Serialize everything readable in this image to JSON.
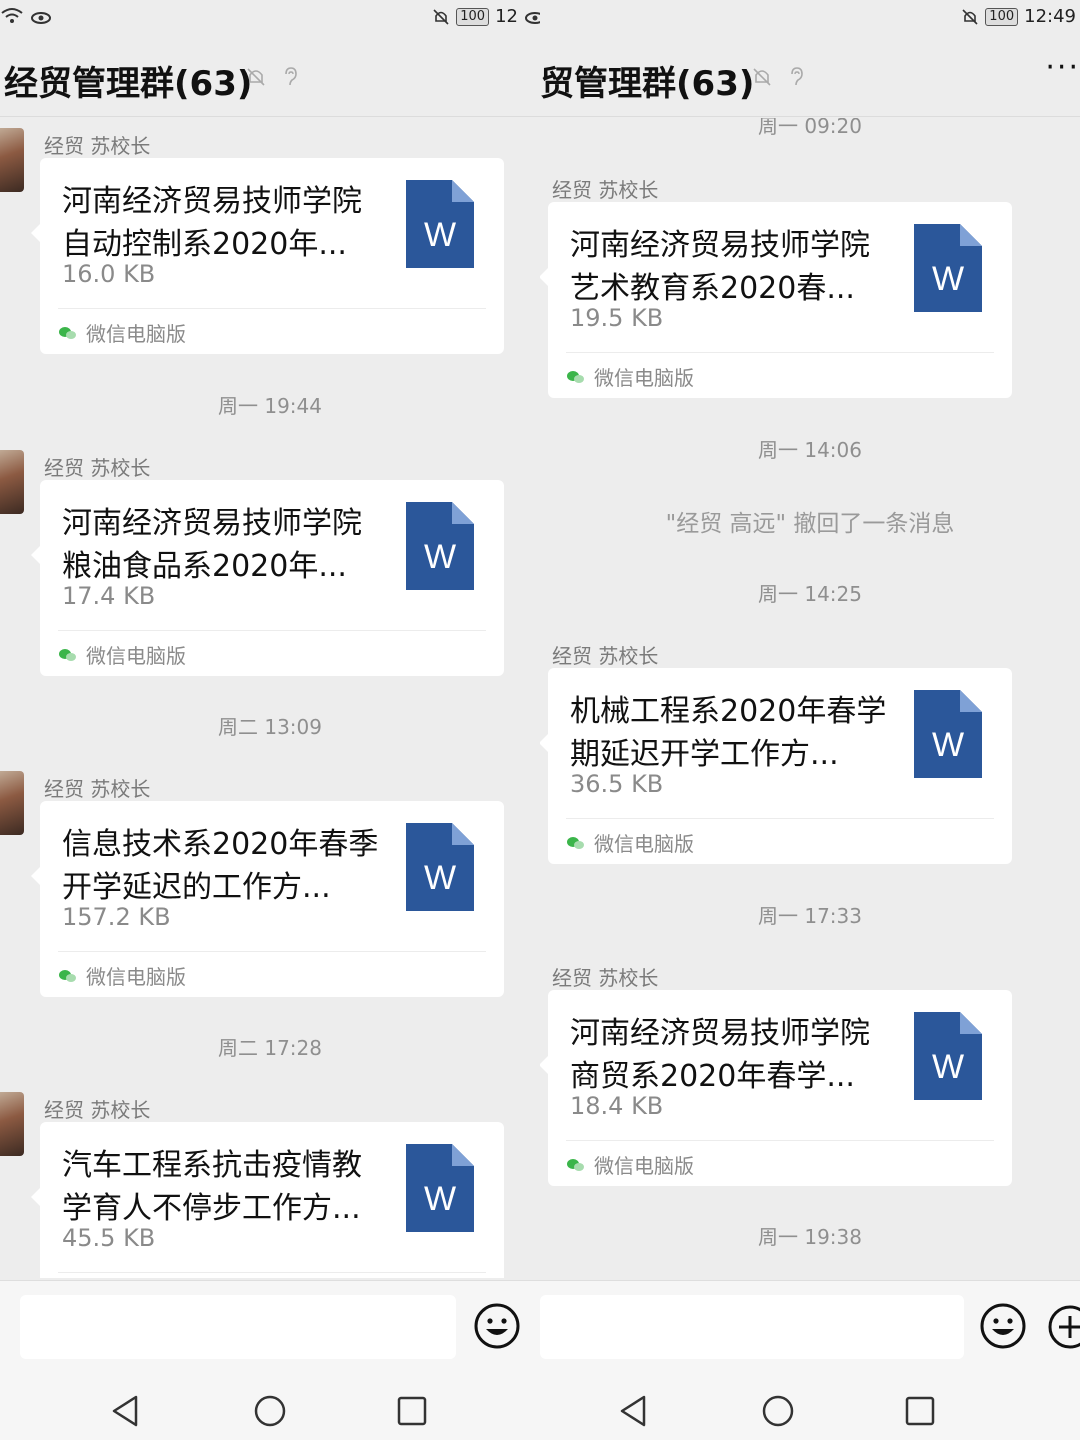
{
  "panes": [
    {
      "status": {
        "left": "",
        "right_time": "12",
        "battery": "100"
      },
      "title": "经贸管理群(63)",
      "messages": [
        {
          "type": "file",
          "sender": "经贸 苏校长",
          "file_name": "河南经济贸易技师学院自动控制系2020年...",
          "size": "16.0 KB",
          "source": "微信电脑版",
          "icon": "word-doc-icon"
        },
        {
          "type": "time",
          "text": "周一 19:44"
        },
        {
          "type": "file",
          "sender": "经贸 苏校长",
          "file_name": "河南经济贸易技师学院粮油食品系2020年...",
          "size": "17.4 KB",
          "source": "微信电脑版",
          "icon": "word-doc-icon"
        },
        {
          "type": "time",
          "text": "周二 13:09"
        },
        {
          "type": "file",
          "sender": "经贸 苏校长",
          "file_name": "信息技术系2020年春季开学延迟的工作方...",
          "size": "157.2 KB",
          "source": "微信电脑版",
          "icon": "word-doc-icon"
        },
        {
          "type": "time",
          "text": "周二 17:28"
        },
        {
          "type": "file",
          "sender": "经贸 苏校长",
          "file_name": "汽车工程系抗击疫情教学育人不停步工作方...",
          "size": "45.5 KB",
          "source": "",
          "icon": "word-doc-icon"
        }
      ]
    },
    {
      "status": {
        "right_time": "12:49",
        "battery": "100"
      },
      "title": "贸管理群(63)",
      "more": "···",
      "messages": [
        {
          "type": "time",
          "text": "周一 09:20"
        },
        {
          "type": "file",
          "sender": "经贸 苏校长",
          "file_name": "河南经济贸易技师学院艺术教育系2020春...",
          "size": "19.5 KB",
          "source": "微信电脑版",
          "icon": "word-doc-icon"
        },
        {
          "type": "time",
          "text": "周一 14:06"
        },
        {
          "type": "system",
          "text": "\"经贸 高远\" 撤回了一条消息"
        },
        {
          "type": "time",
          "text": "周一 14:25"
        },
        {
          "type": "file",
          "sender": "经贸 苏校长",
          "file_name": "机械工程系2020年春学期延迟开学工作方...",
          "size": "36.5 KB",
          "source": "微信电脑版",
          "icon": "word-doc-icon"
        },
        {
          "type": "time",
          "text": "周一 17:33"
        },
        {
          "type": "file",
          "sender": "经贸 苏校长",
          "file_name": "河南经济贸易技师学院商贸系2020年春学...",
          "size": "18.4 KB",
          "source": "微信电脑版",
          "icon": "word-doc-icon"
        },
        {
          "type": "time",
          "text": "周一 19:38"
        }
      ]
    }
  ],
  "doc_icon_letter": "W",
  "colors": {
    "background": "#ededed",
    "card": "#ffffff",
    "word_blue": "#2b579a",
    "wechat_green": "#3bb54a"
  }
}
